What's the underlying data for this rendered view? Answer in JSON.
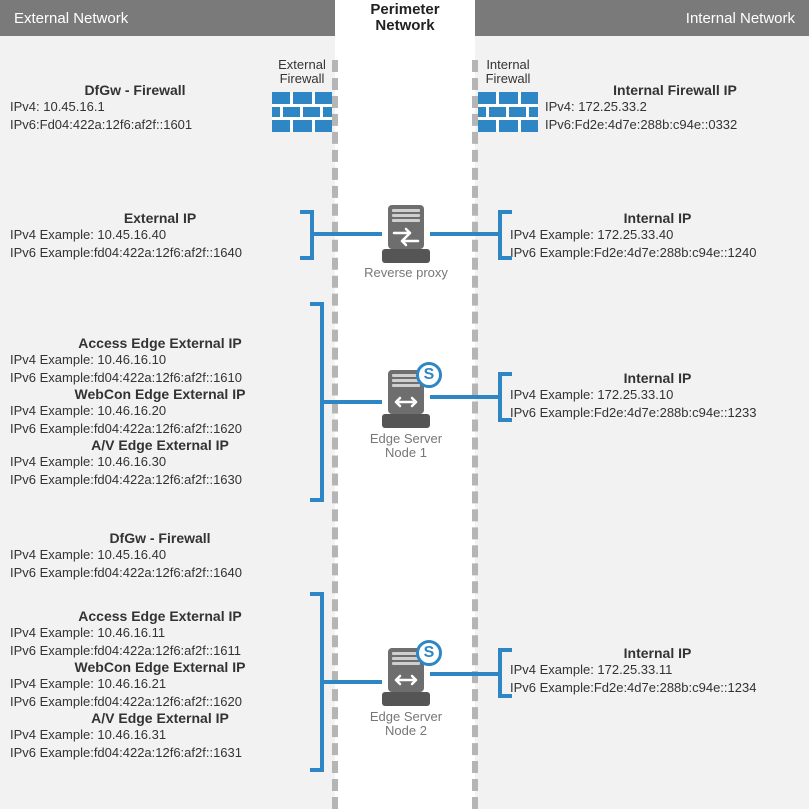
{
  "headers": {
    "external": "External Network",
    "perimeter_l1": "Perimeter",
    "perimeter_l2": "Network",
    "internal": "Internal Network"
  },
  "fw_labels": {
    "ext_l1": "External",
    "ext_l2": "Firewall",
    "int_l1": "Internal",
    "int_l2": "Firewall"
  },
  "dfgw_firewall": {
    "title": "DfGw - Firewall",
    "ipv4": "IPv4: 10.45.16.1",
    "ipv6": "IPv6:Fd04:422a:12f6:af2f::1601"
  },
  "internal_fw": {
    "title": "Internal Firewall IP",
    "ipv4": "IPv4: 172.25.33.2",
    "ipv6": "IPv6:Fd2e:4d7e:288b:c94e::0332"
  },
  "external_ip": {
    "title": "External IP",
    "ipv4": "IPv4 Example: 10.45.16.40",
    "ipv6": "IPv6 Example:fd04:422a:12f6:af2f::1640"
  },
  "rp_internal": {
    "title": "Internal IP",
    "ipv4": "IPv4 Example: 172.25.33.40",
    "ipv6": "IPv6 Example:Fd2e:4d7e:288b:c94e::1240"
  },
  "reverse_proxy_label": "Reverse proxy",
  "edge1_ext": {
    "access_title": "Access Edge External IP",
    "access_ipv4": "IPv4 Example: 10.46.16.10",
    "access_ipv6": "IPv6 Example:fd04:422a:12f6:af2f::1610",
    "webcon_title": "WebCon Edge External IP",
    "webcon_ipv4": "IPv4 Example: 10.46.16.20",
    "webcon_ipv6": "IPv6 Example:fd04:422a:12f6:af2f::1620",
    "av_title": "A/V Edge External IP",
    "av_ipv4": "IPv4 Example: 10.46.16.30",
    "av_ipv6": "IPv6 Example:fd04:422a:12f6:af2f::1630"
  },
  "edge1_int": {
    "title": "Internal IP",
    "ipv4": "IPv4 Example: 172.25.33.10",
    "ipv6": "IPv6 Example:Fd2e:4d7e:288b:c94e::1233"
  },
  "edge1_label_l1": "Edge Server",
  "edge1_label_l2": "Node 1",
  "dfgw_fw2": {
    "title": "DfGw - Firewall",
    "ipv4": "IPv4 Example: 10.45.16.40",
    "ipv6": "IPv6 Example:fd04:422a:12f6:af2f::1640"
  },
  "edge2_ext": {
    "access_title": "Access Edge External IP",
    "access_ipv4": "IPv4 Example: 10.46.16.11",
    "access_ipv6": "IPv6 Example:fd04:422a:12f6:af2f::1611",
    "webcon_title": "WebCon Edge External IP",
    "webcon_ipv4": "IPv4 Example: 10.46.16.21",
    "webcon_ipv6": "IPv6 Example:fd04:422a:12f6:af2f::1620",
    "av_title": "A/V Edge External IP",
    "av_ipv4": "IPv4 Example: 10.46.16.31",
    "av_ipv6": "IPv6 Example:fd04:422a:12f6:af2f::1631"
  },
  "edge2_int": {
    "title": "Internal IP",
    "ipv4": "IPv4 Example: 172.25.33.11",
    "ipv6": "IPv6 Example:Fd2e:4d7e:288b:c94e::1234"
  },
  "edge2_label_l1": "Edge Server",
  "edge2_label_l2": "Node 2",
  "skype_glyph": "S"
}
